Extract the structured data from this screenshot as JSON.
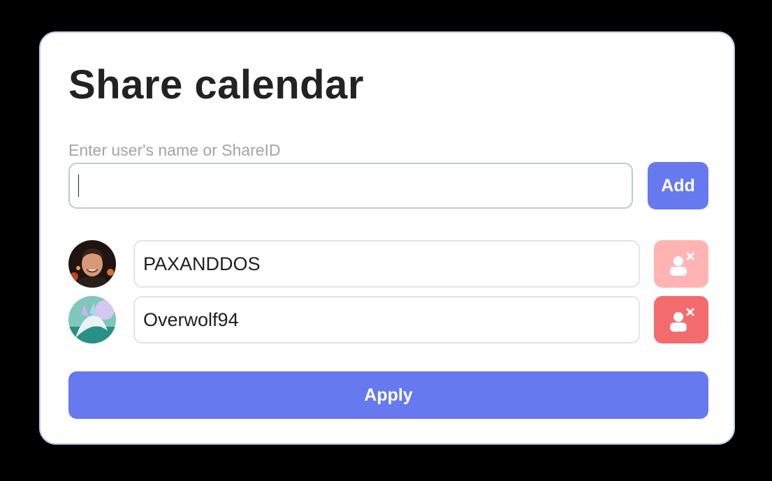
{
  "dialog": {
    "title": "Share calendar",
    "input_label": "Enter user's name or ShareID",
    "input_value": "",
    "add_label": "Add",
    "apply_label": "Apply"
  },
  "users": [
    {
      "name": "PAXANDDOS",
      "avatar_icon": "user-avatar-photo",
      "remove_icon": "remove-user-icon",
      "remove_state": "disabled"
    },
    {
      "name": "Overwolf94",
      "avatar_icon": "user-avatar-illustration",
      "remove_icon": "remove-user-icon",
      "remove_state": "active"
    }
  ],
  "colors": {
    "accent": "#6779ee",
    "remove_active": "#f46b6d",
    "remove_disabled": "#ffb4b3",
    "border": "#bfc5e6",
    "title": "#222222",
    "label": "#a4a4a4"
  }
}
